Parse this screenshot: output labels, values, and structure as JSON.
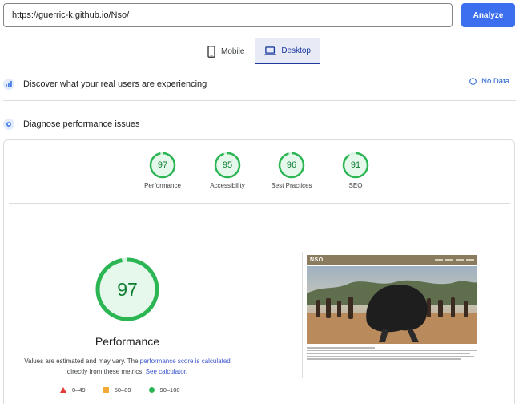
{
  "top": {
    "url_value": "https://guerric-k.github.io/Nso/",
    "analyze_label": "Analyze"
  },
  "device_tabs": {
    "mobile_label": "Mobile",
    "desktop_label": "Desktop",
    "selected": "Desktop"
  },
  "sections": {
    "discover_title": "Discover what your real users are experiencing",
    "no_data_label": "No Data",
    "diagnose_title": "Diagnose performance issues"
  },
  "scores": [
    {
      "label": "Performance",
      "value": 97
    },
    {
      "label": "Accessibility",
      "value": 95
    },
    {
      "label": "Best Practices",
      "value": 96
    },
    {
      "label": "SEO",
      "value": 91
    }
  ],
  "main_score": {
    "value": "97",
    "title": "Performance"
  },
  "note": {
    "prefix": "Values are estimated and may vary. The ",
    "link1": "performance score is calculated",
    "middle": "directly from these metrics. ",
    "link2": "See calculator."
  },
  "legend": {
    "fail": "0–49",
    "average": "50–89",
    "pass": "90–100"
  },
  "screenshot_preview": {
    "logo_text": "NSO"
  },
  "colors": {
    "accent": "#3c6ef0",
    "pass": "#0cce6b",
    "pass_text": "#0a7d2e",
    "average": "#f4a93b",
    "fail": "#e53935"
  }
}
